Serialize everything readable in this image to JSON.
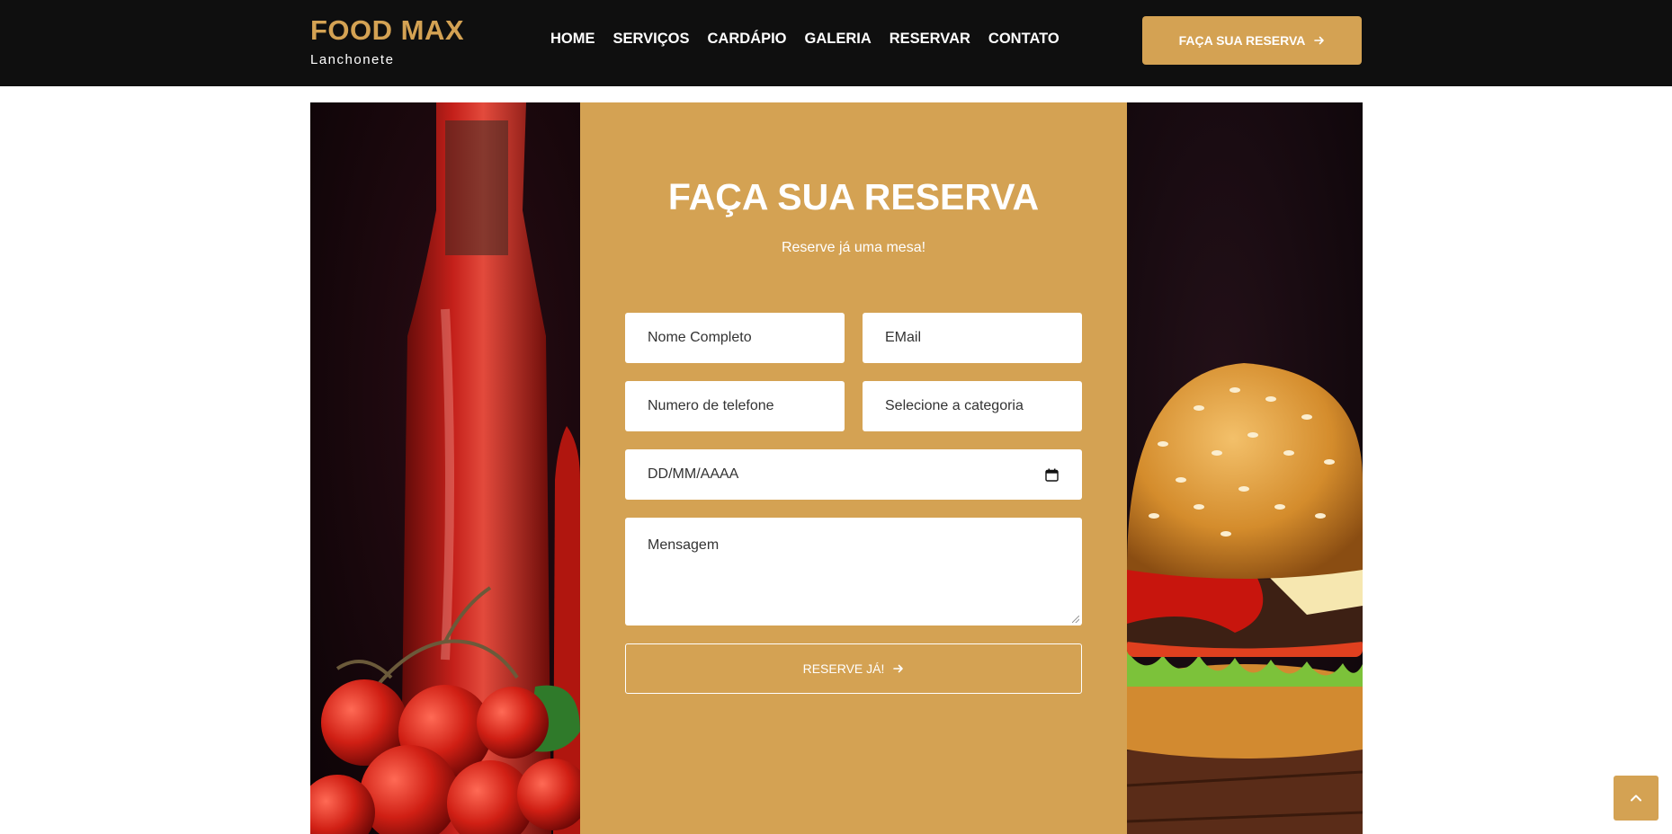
{
  "brand": {
    "title": "FOOD MAX",
    "subtitle": "Lanchonete"
  },
  "nav": {
    "items": [
      "HOME",
      "SERVIÇOS",
      "CARDÁPIO",
      "GALERIA",
      "RESERVAR",
      "CONTATO"
    ]
  },
  "header_cta": {
    "label": "FAÇA SUA RESERVA",
    "icon": "arrow-right-icon"
  },
  "reservation": {
    "title": "FAÇA SUA RESERVA",
    "subtitle": "Reserve já uma mesa!",
    "fields": {
      "name_placeholder": "Nome Completo",
      "email_placeholder": "EMail",
      "phone_placeholder": "Numero de telefone",
      "category_placeholder": "Selecione a categoria",
      "date_placeholder": "DD/MM/AAAA",
      "message_placeholder": "Mensagem"
    },
    "submit_label": "RESERVE JÁ!"
  },
  "images": {
    "left": "ketchup-bottle-and-tomatoes",
    "right": "hamburger"
  },
  "colors": {
    "accent": "#d4a253",
    "header_bg": "#0f0f0f",
    "text_light": "#ffffff"
  }
}
